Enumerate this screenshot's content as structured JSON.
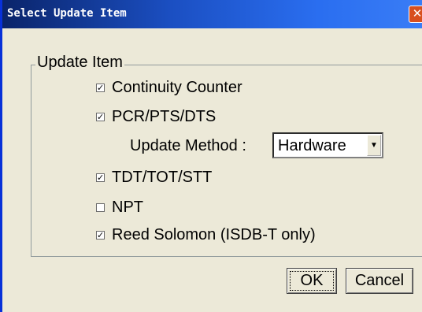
{
  "window": {
    "title": "Select Update Item",
    "close_symbol": "✕"
  },
  "group": {
    "legend": "Update Item",
    "items": [
      {
        "label": "Continuity Counter",
        "checked": true
      },
      {
        "label": "PCR/PTS/DTS",
        "checked": true
      },
      {
        "label": "TDT/TOT/STT",
        "checked": true
      },
      {
        "label": "NPT",
        "checked": false
      },
      {
        "label": "Reed Solomon (ISDB-T only)",
        "checked": true
      }
    ],
    "update_method": {
      "label": "Update Method :",
      "value": "Hardware"
    }
  },
  "buttons": {
    "ok": "OK",
    "cancel": "Cancel"
  }
}
